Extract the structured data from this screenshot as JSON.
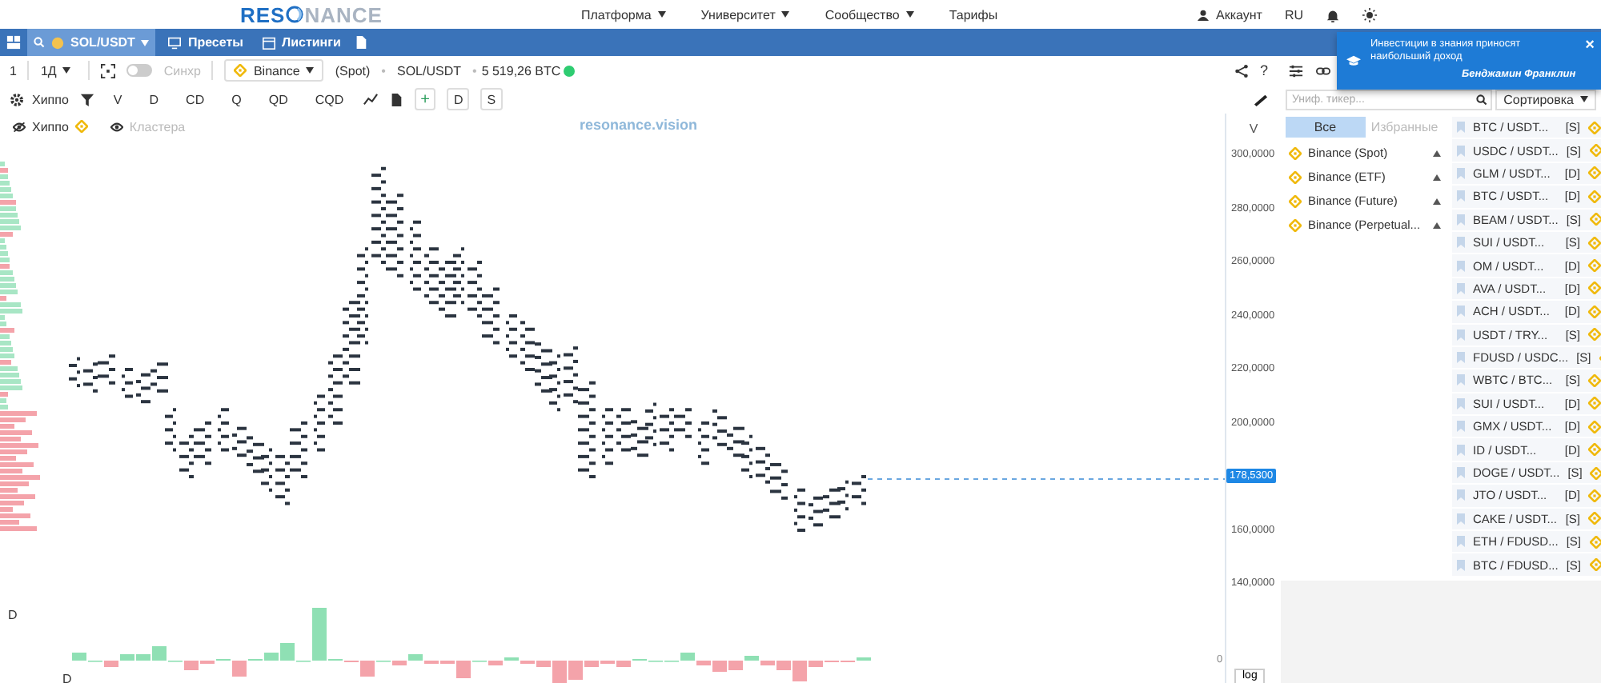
{
  "logo": {
    "left": "RES",
    "right": "NANCE"
  },
  "nav": [
    {
      "label": "Платформа",
      "dropdown": true
    },
    {
      "label": "Университет",
      "dropdown": true
    },
    {
      "label": "Сообщество",
      "dropdown": true
    },
    {
      "label": "Тарифы",
      "dropdown": false
    }
  ],
  "account": {
    "label": "Аккаунт",
    "language": "RU"
  },
  "blue_bar": {
    "symbol": "SOL/USDT",
    "presets": "Пресеты",
    "listings": "Листинги"
  },
  "toolbar": {
    "count": "1",
    "interval": "1Д",
    "sync": {
      "label": "Синхр",
      "on": false
    },
    "exchange": "Binance",
    "market": "(Spot)",
    "pair": "SOL/USDT",
    "volume": "5 519,26 BTC",
    "help": "?",
    "separators": [
      "•",
      "•"
    ]
  },
  "indicators": {
    "main": "Хиппо",
    "items": [
      "V",
      "D",
      "CD",
      "Q",
      "QD",
      "CQD"
    ],
    "buttons": [
      "+",
      "D",
      "S"
    ]
  },
  "legend": [
    {
      "label": "Хиппо",
      "visible": false,
      "disabled": false
    },
    {
      "label": "Кластера",
      "visible": true,
      "disabled": true
    }
  ],
  "chart_caption": "resonance.vision",
  "price_axis": {
    "title": "V",
    "ticks": [
      "300,0000",
      "280,0000",
      "260,0000",
      "240,0000",
      "220,0000",
      "200,0000",
      "160,0000",
      "140,0000"
    ],
    "current": "178,5300",
    "zero": "0",
    "scale_button": "log"
  },
  "delta_labels": [
    "D",
    "D"
  ],
  "panel": {
    "search_placeholder": "Униф. тикер...",
    "sort": "Сортировка",
    "tabs": [
      {
        "label": "Все",
        "selected": true
      },
      {
        "label": "Избранные",
        "selected": false
      }
    ],
    "exchanges": [
      {
        "name": "Binance (Spot)",
        "expanded": true
      },
      {
        "name": "Binance (ETF)",
        "expanded": true
      },
      {
        "name": "Binance (Future)",
        "expanded": true
      },
      {
        "name": "Binance (Perpetual...",
        "expanded": true
      }
    ],
    "tickers": [
      {
        "pair": "BTC / USDT...",
        "type": "[S]"
      },
      {
        "pair": "USDC / USDT...",
        "type": "[S]"
      },
      {
        "pair": "GLM / USDT...",
        "type": "[D]"
      },
      {
        "pair": "BTC / USDT...",
        "type": "[D]"
      },
      {
        "pair": "BEAM / USDT...",
        "type": "[S]"
      },
      {
        "pair": "SUI / USDT...",
        "type": "[S]"
      },
      {
        "pair": "OM / USDT...",
        "type": "[D]"
      },
      {
        "pair": "AVA / USDT...",
        "type": "[D]"
      },
      {
        "pair": "ACH / USDT...",
        "type": "[D]"
      },
      {
        "pair": "USDT / TRY...",
        "type": "[S]"
      },
      {
        "pair": "FDUSD / USDC...",
        "type": "[S]"
      },
      {
        "pair": "WBTC / BTC...",
        "type": "[S]"
      },
      {
        "pair": "SUI / USDT...",
        "type": "[D]"
      },
      {
        "pair": "GMX / USDT...",
        "type": "[D]"
      },
      {
        "pair": "ID / USDT...",
        "type": "[D]"
      },
      {
        "pair": "DOGE / USDT...",
        "type": "[S]"
      },
      {
        "pair": "JTO / USDT...",
        "type": "[D]"
      },
      {
        "pair": "CAKE / USDT...",
        "type": "[S]"
      },
      {
        "pair": "ETH / FDUSD...",
        "type": "[S]"
      },
      {
        "pair": "BTC / FDUSD...",
        "type": "[S]"
      }
    ]
  },
  "toast": {
    "quote": "Инвестиции в знания приносят наибольший доход",
    "author": "Бенджамин Франклин",
    "close": "×"
  }
}
